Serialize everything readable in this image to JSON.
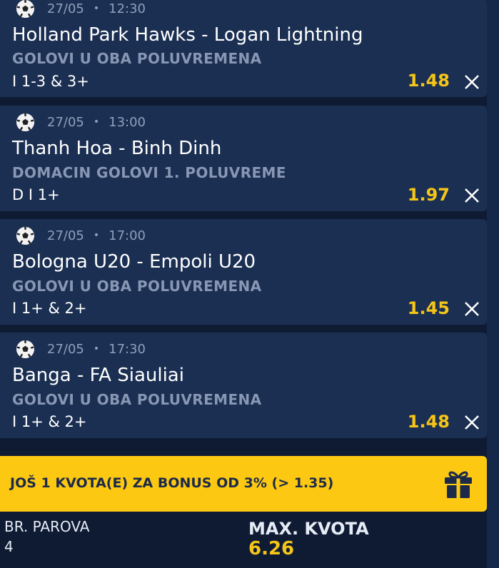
{
  "matches": [
    {
      "date": "27/05",
      "time": "12:30",
      "teams": "Holland Park Hawks - Logan Lightning",
      "market": "GOLOVI U OBA POLUVREMENA",
      "pick": "I 1-3 & 3+",
      "odd": "1.48"
    },
    {
      "date": "27/05",
      "time": "13:00",
      "teams": "Thanh Hoa - Binh Dinh",
      "market": "DOMACIN GOLOVI 1. POLUVREME",
      "pick": "D I 1+",
      "odd": "1.97"
    },
    {
      "date": "27/05",
      "time": "17:00",
      "teams": "Bologna U20 - Empoli U20",
      "market": "GOLOVI U OBA POLUVREMENA",
      "pick": "I 1+ & 2+",
      "odd": "1.45"
    },
    {
      "date": "27/05",
      "time": "17:30",
      "teams": "Banga - FA Siauliai",
      "market": "GOLOVI U OBA POLUVREMENA",
      "pick": "I 1+ & 2+",
      "odd": "1.48"
    }
  ],
  "separator": "•",
  "bonus": {
    "text": "JOŠ 1 KVOTA(E) ZA BONUS OD 3% (> 1.35)",
    "icon": "gift-icon"
  },
  "footer": {
    "pairs_label": "BR. PAROVA",
    "pairs_value": "4",
    "max_label": "MAX. KVOTA",
    "max_value": "6.26"
  },
  "colors": {
    "accent": "#f5c518",
    "card": "#1b2f52",
    "background": "#0f1b33",
    "bonus": "#fcc812"
  }
}
